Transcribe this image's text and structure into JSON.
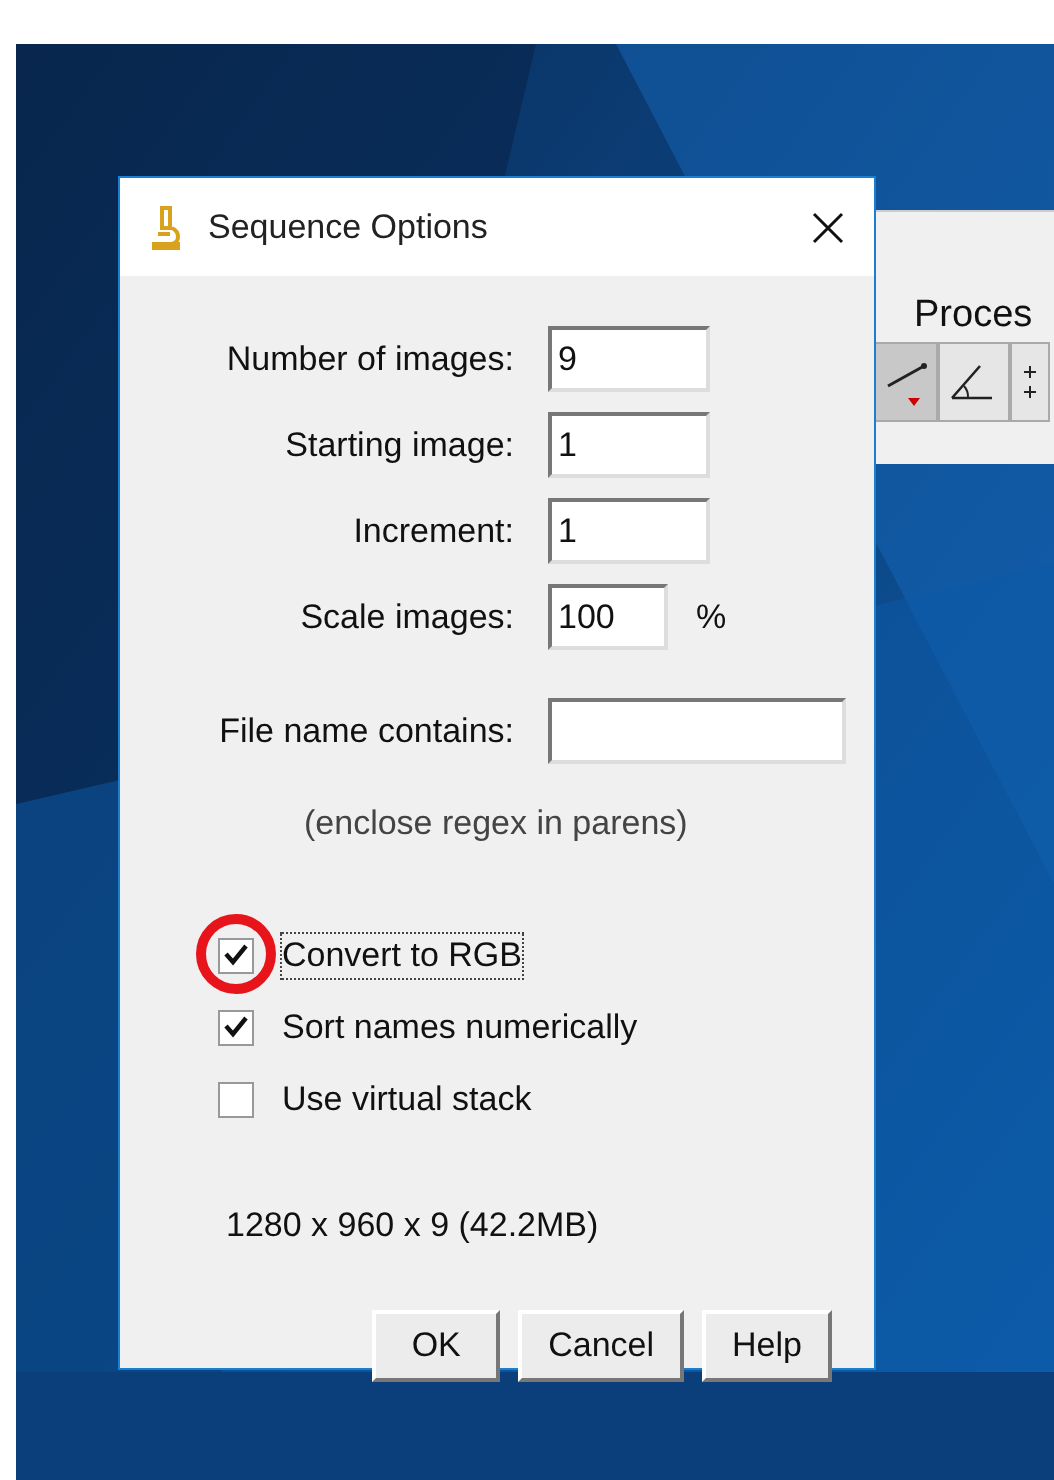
{
  "background_window": {
    "menu_label": "Proces",
    "tools": [
      {
        "kind": "line",
        "selected": true
      },
      {
        "kind": "angle",
        "selected": false
      },
      {
        "kind": "points",
        "selected": false
      }
    ]
  },
  "dialog": {
    "title": "Sequence Options",
    "fields": [
      {
        "label": "Number of images:",
        "value": "9",
        "kind": "short"
      },
      {
        "label": "Starting image:",
        "value": "1",
        "kind": "short"
      },
      {
        "label": "Increment:",
        "value": "1",
        "kind": "short"
      },
      {
        "label": "Scale images:",
        "value": "100",
        "kind": "narrow",
        "suffix": "%"
      },
      {
        "label": "File name contains:",
        "kind": "wide"
      }
    ],
    "hint": "(enclose regex in parens)",
    "checkboxes": [
      {
        "label": "Convert to RGB",
        "checked": true,
        "focused": true,
        "highlighted": true
      },
      {
        "label": "Sort names numerically",
        "checked": true,
        "focused": false,
        "highlighted": false
      },
      {
        "label": "Use virtual stack",
        "checked": false,
        "focused": false,
        "highlighted": false
      }
    ],
    "info": "1280 x 960 x 9 (42.2MB)",
    "buttons": [
      "OK",
      "Cancel",
      "Help"
    ]
  }
}
